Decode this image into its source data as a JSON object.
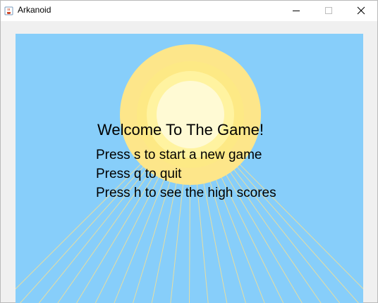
{
  "window": {
    "title": "Arkanoid",
    "icon": "java-cup-icon"
  },
  "controls": {
    "minimize_icon": "minimize-icon",
    "maximize_icon": "maximize-icon",
    "close_icon": "close-icon"
  },
  "screen": {
    "welcome": "Welcome To The Game!",
    "options": [
      "Press s to start a new game",
      "Press q to quit",
      "Press h to see the high scores"
    ]
  },
  "colors": {
    "background": "#87cefa",
    "sun_outer": "#fde68a",
    "sun_middle": "#fdeb86",
    "sun_inner": "#fff3a6",
    "sun_core": "#fffad6",
    "rays": "#e8e0a0"
  }
}
